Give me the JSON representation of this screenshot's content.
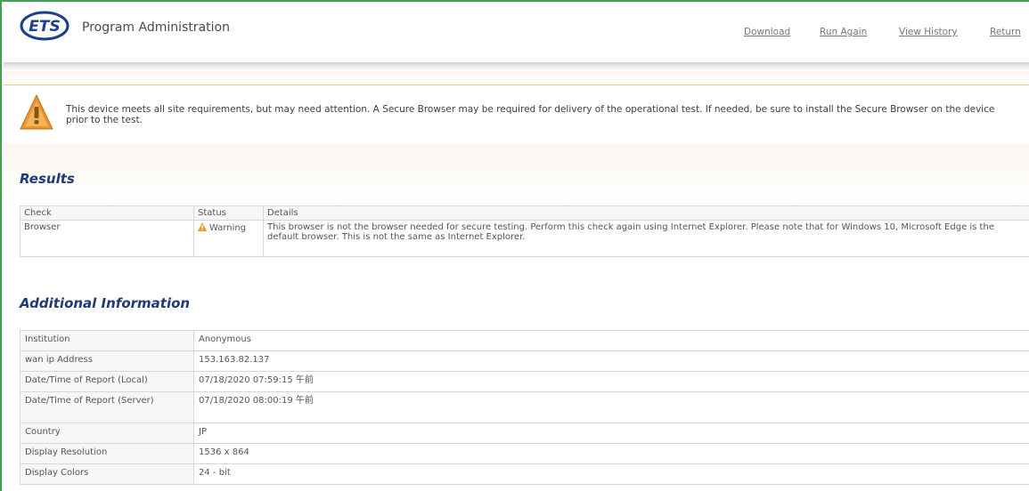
{
  "header": {
    "logo_text": "ETS",
    "title": "Program Administration",
    "nav": {
      "download": "Download",
      "run_again": "Run Again",
      "view_history": "View History",
      "return": "Return"
    }
  },
  "notice": {
    "icon": "warning-triangle-icon",
    "text": "This device meets all site requirements, but may need attention. A Secure Browser may be required for delivery of the operational test. If needed, be sure to install the Secure Browser on the device prior to the test."
  },
  "results": {
    "title": "Results",
    "columns": [
      "Check",
      "Status",
      "Details"
    ],
    "rows": [
      {
        "check": "Browser",
        "status": "Warning",
        "details": "This browser is not the browser needed for secure testing. Perform this check again using Internet Explorer. Please note that for Windows 10, Microsoft Edge is the default browser. This is not the same as Internet Explorer."
      }
    ]
  },
  "additional": {
    "title": "Additional Information",
    "rows": [
      {
        "label": "Institution",
        "value": "Anonymous"
      },
      {
        "label": "wan ip Address",
        "value": "153.163.82.137"
      },
      {
        "label": "Date/Time of Report (Local)",
        "value": "07/18/2020 07:59:15 午前"
      },
      {
        "label": "Date/Time of Report (Server)",
        "value": "07/18/2020 08:00:19 午前"
      },
      {
        "label": "Country",
        "value": "JP"
      },
      {
        "label": "Display Resolution",
        "value": "1536 x 864"
      },
      {
        "label": "Display Colors",
        "value": "24 - bit"
      }
    ]
  },
  "colors": {
    "frame_border": "#3fa54a",
    "section_title": "#1f3a7a",
    "warning": "#e8952a"
  }
}
